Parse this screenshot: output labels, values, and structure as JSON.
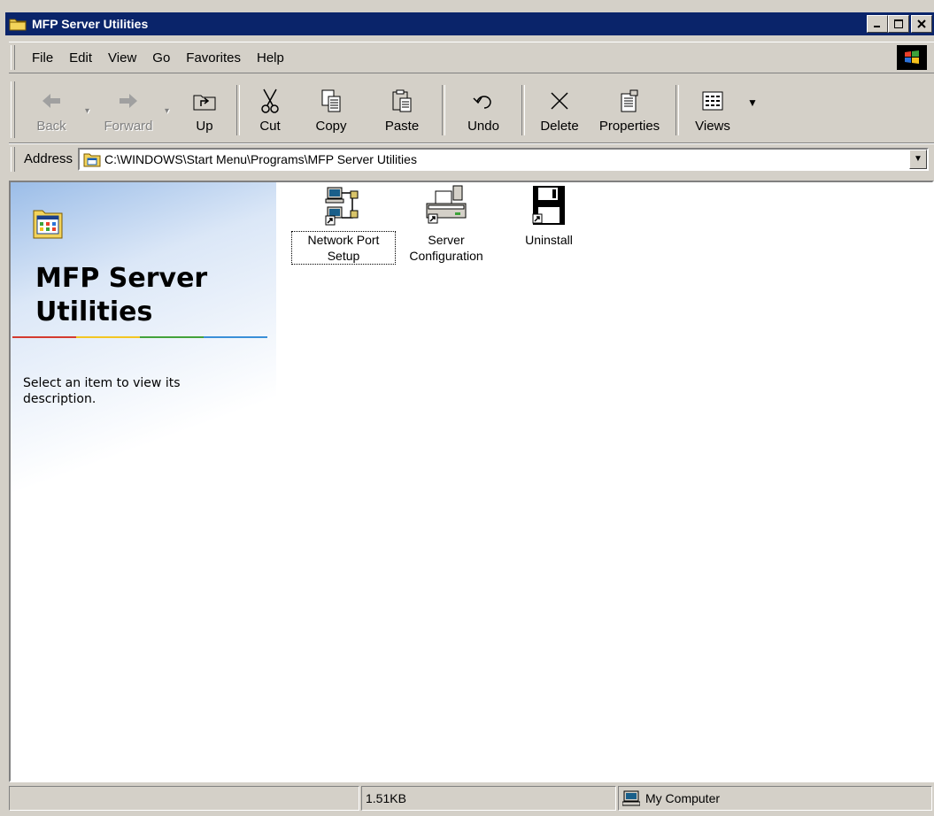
{
  "window": {
    "title": "MFP Server Utilities",
    "controls": [
      "_",
      "□",
      "X"
    ]
  },
  "menu": [
    "File",
    "Edit",
    "View",
    "Go",
    "Favorites",
    "Help"
  ],
  "toolbar": {
    "back": "Back",
    "forward": "Forward",
    "up": "Up",
    "cut": "Cut",
    "copy": "Copy",
    "paste": "Paste",
    "undo": "Undo",
    "delete": "Delete",
    "properties": "Properties",
    "views": "Views"
  },
  "address": {
    "label": "Address",
    "value": "C:\\WINDOWS\\Start Menu\\Programs\\MFP Server Utilities"
  },
  "webview": {
    "title": "MFP Server Utilities",
    "description": "Select an item to view its description."
  },
  "files": [
    {
      "label": "Network Port Setup",
      "icon": "network-port-icon",
      "selected": true
    },
    {
      "label": "Server Configuration",
      "icon": "printer-icon",
      "selected": false
    },
    {
      "label": "Uninstall",
      "icon": "floppy-icon",
      "selected": false
    }
  ],
  "status": {
    "size": "1.51KB",
    "location": "My Computer"
  }
}
